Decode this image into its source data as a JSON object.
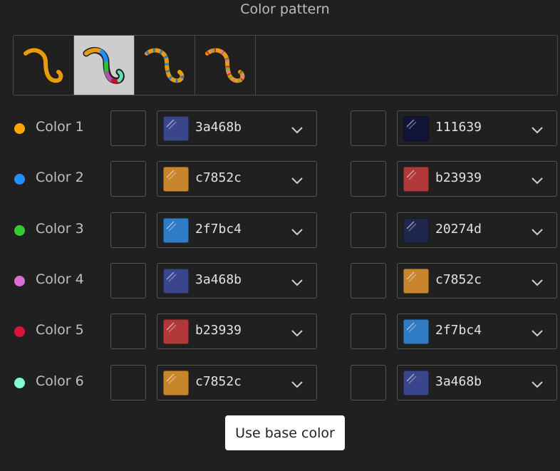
{
  "title": "Color pattern",
  "patterns": [
    {
      "name": "solid",
      "selected": false
    },
    {
      "name": "multicolor",
      "selected": true
    },
    {
      "name": "dotted",
      "selected": false
    },
    {
      "name": "speckled",
      "selected": false
    }
  ],
  "rows": [
    {
      "label": "Color 1",
      "dot": "#ffa500",
      "left": {
        "hex": "3a468b",
        "color": "#3a468b"
      },
      "right": {
        "hex": "111639",
        "color": "#111639"
      }
    },
    {
      "label": "Color 2",
      "dot": "#1e90ff",
      "left": {
        "hex": "c7852c",
        "color": "#c7852c"
      },
      "right": {
        "hex": "b23939",
        "color": "#b23939"
      }
    },
    {
      "label": "Color 3",
      "dot": "#32cd32",
      "left": {
        "hex": "2f7bc4",
        "color": "#2f7bc4"
      },
      "right": {
        "hex": "20274d",
        "color": "#20274d"
      }
    },
    {
      "label": "Color 4",
      "dot": "#da70d6",
      "left": {
        "hex": "3a468b",
        "color": "#3a468b"
      },
      "right": {
        "hex": "c7852c",
        "color": "#c7852c"
      }
    },
    {
      "label": "Color 5",
      "dot": "#dc143c",
      "left": {
        "hex": "b23939",
        "color": "#b23939"
      },
      "right": {
        "hex": "2f7bc4",
        "color": "#2f7bc4"
      }
    },
    {
      "label": "Color 6",
      "dot": "#7fffd4",
      "left": {
        "hex": "c7852c",
        "color": "#c7852c"
      },
      "right": {
        "hex": "3a468b",
        "color": "#3a468b"
      }
    }
  ],
  "use_base_label": "Use base color"
}
